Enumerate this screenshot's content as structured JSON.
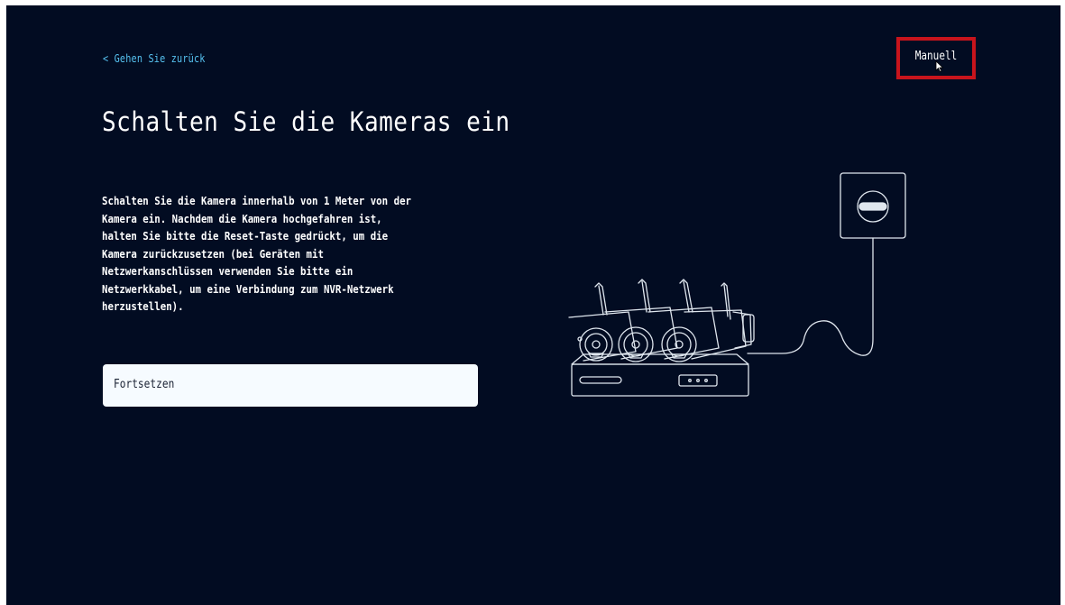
{
  "header": {
    "back_label": "< Gehen Sie zurück",
    "manual_label": "Manuell"
  },
  "main": {
    "title": "Schalten Sie die Kameras ein",
    "description": "Schalten Sie die Kamera innerhalb von 1 Meter von der\nKamera ein. Nachdem die Kamera hochgefahren ist,\nhalten Sie bitte die Reset-Taste gedrückt, um die\nKamera zurückzusetzen (bei Geräten mit\nNetzwerkanschlüssen verwenden Sie bitte ein\nNetzwerkkabel, um eine Verbindung zum NVR-Netzwerk\nherzustellen).",
    "continue_label": "Fortsetzen"
  },
  "colors": {
    "background": "#020c22",
    "link": "#56c2f0",
    "highlight_box": "#c8141c",
    "button_bg": "#f6fbff"
  },
  "icons": {
    "illustration": "cameras-nvr-power-illustration",
    "cursor": "mouse-pointer-icon"
  }
}
